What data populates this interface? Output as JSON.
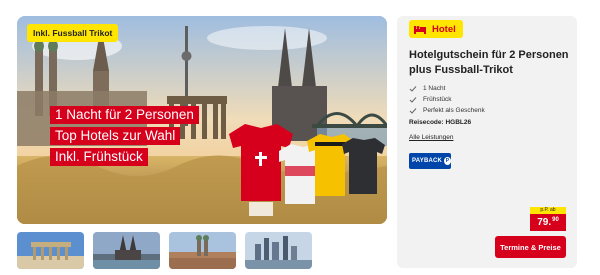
{
  "gallery": {
    "badge": "Inkl. Fussball Trikot",
    "headline_lines": [
      "1 Nacht für 2 Personen",
      "Top Hotels zur Wahl",
      "Inkl. Frühstück"
    ],
    "thumbnails": [
      "brandenburger-tor",
      "koelner-dom",
      "muenchen-frauenkirche",
      "frankfurt-skyline"
    ]
  },
  "offer": {
    "category_tag": "Hotel",
    "category_icon": "bed-icon",
    "title": "Hotelgutschein für 2 Personen plus Fussball-Trikot",
    "features": [
      "1 Nacht",
      "Frühstück",
      "Perfekt als Geschenk"
    ],
    "reisecode": "Reisecode: HGBL26",
    "all_link": "Alle Leistungen",
    "payback": "PAYBACK",
    "price_from": "p.P. ab",
    "price_main": "79.",
    "price_cents": "90",
    "cta": "Termine & Preise"
  },
  "colors": {
    "brand_red": "#d6001c",
    "brand_yellow": "#ffe500",
    "payback_blue": "#0046aa"
  }
}
